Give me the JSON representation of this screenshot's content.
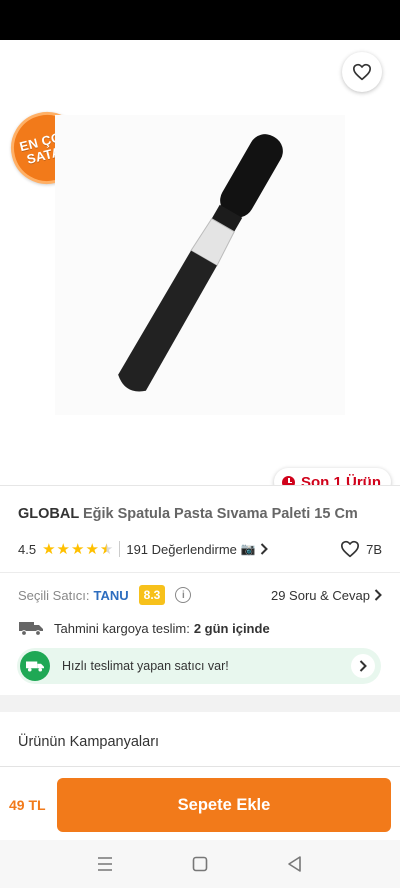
{
  "header": {
    "icons": [
      "back-arrow-icon",
      "share-icon",
      "heart-outline-icon"
    ]
  },
  "badges": {
    "best_seller_line1": "EN ÇOK",
    "best_seller_line2": "SATAN",
    "stock": "Son 1 Ürün"
  },
  "product": {
    "brand": "GLOBAL",
    "name": "Eğik Spatula Pasta Sıvama Paleti 15 Cm",
    "rating": "4.5",
    "rating_stars_value": 4.5,
    "reviews": "191 Değerlendirme",
    "likes": "7B"
  },
  "seller": {
    "label": "Seçili Satıcı:",
    "name": "TANU",
    "score": "8.3",
    "qa": "29 Soru & Cevap"
  },
  "shipping": {
    "label": "Tahmini kargoya teslim:",
    "value": "2 gün içinde",
    "fast_text": "Hızlı teslimat yapan satıcı var!"
  },
  "campaigns": {
    "title": "Ürünün Kampanyaları"
  },
  "buy": {
    "price": "49 TL",
    "add_to_cart": "Sepete Ekle"
  },
  "colors": {
    "accent": "#f27a1a",
    "stock_red": "#d0021b",
    "seller_blue": "#2d6dbf",
    "score_yellow": "#f7c11b",
    "fast_green": "#1fa855",
    "star": "#ffc000"
  }
}
